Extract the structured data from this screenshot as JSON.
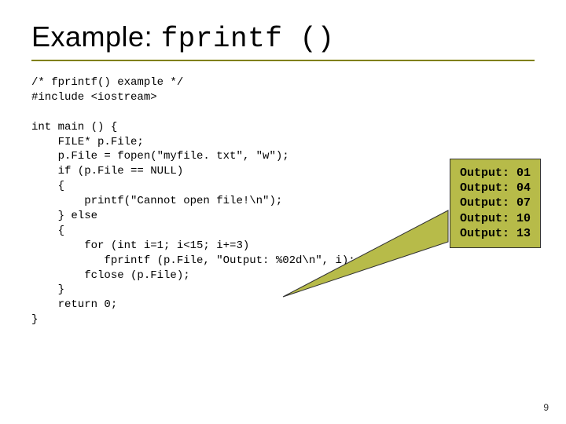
{
  "title": {
    "plain": "Example: ",
    "mono": "fprintf ()"
  },
  "code": "/* fprintf() example */\n#include <iostream>\n\nint main () {\n    FILE* p.File;\n    p.File = fopen(\"myfile. txt\", \"w\");\n    if (p.File == NULL)\n    {\n        printf(\"Cannot open file!\\n\");\n    } else\n    {\n        for (int i=1; i<15; i+=3)\n           fprintf (p.File, \"Output: %02d\\n\", i);\n        fclose (p.File);\n    }\n    return 0;\n}",
  "output": {
    "lines": [
      "Output: 01",
      "Output: 04",
      "Output: 07",
      "Output: 10",
      "Output: 13"
    ]
  },
  "page_number": "9"
}
